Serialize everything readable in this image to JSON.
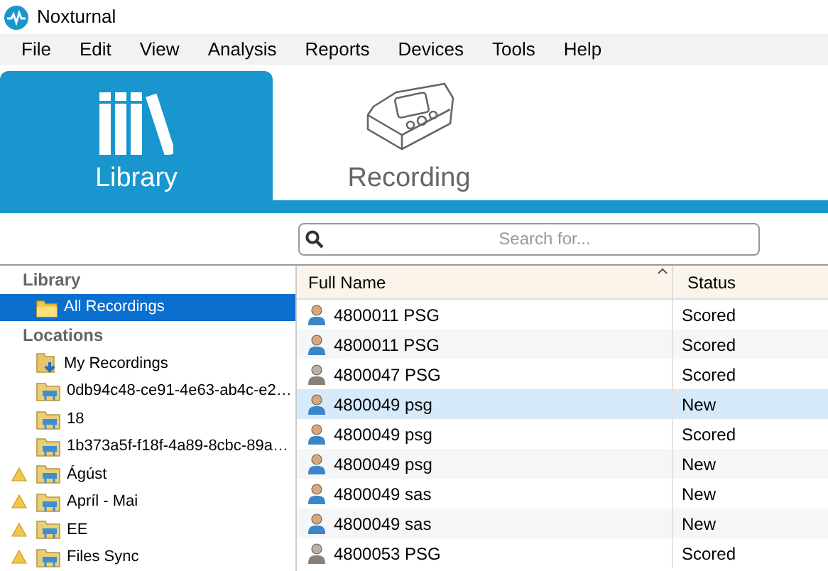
{
  "window": {
    "title": "Noxturnal"
  },
  "menu": [
    "File",
    "Edit",
    "View",
    "Analysis",
    "Reports",
    "Devices",
    "Tools",
    "Help"
  ],
  "tabs": [
    {
      "label": "Library",
      "kind": "library",
      "selected": true
    },
    {
      "label": "Recording",
      "kind": "device",
      "selected": false
    }
  ],
  "search": {
    "placeholder": "Search for..."
  },
  "sidebar": {
    "sections": [
      {
        "title": "Library",
        "items": [
          {
            "label": "All Recordings",
            "kind": "plain",
            "warning": false,
            "selected": true
          }
        ]
      },
      {
        "title": "Locations",
        "items": [
          {
            "label": "My Recordings",
            "kind": "download",
            "warning": false,
            "selected": false
          },
          {
            "label": "0db94c48-ce91-4e63-ab4c-e2…",
            "kind": "network",
            "warning": false,
            "selected": false
          },
          {
            "label": "18",
            "kind": "network",
            "warning": false,
            "selected": false
          },
          {
            "label": "1b373a5f-f18f-4a89-8cbc-89a…",
            "kind": "network",
            "warning": false,
            "selected": false
          },
          {
            "label": "Ágúst",
            "kind": "network",
            "warning": true,
            "selected": false
          },
          {
            "label": "Apríl - Mai",
            "kind": "network",
            "warning": true,
            "selected": false
          },
          {
            "label": "EE",
            "kind": "network",
            "warning": true,
            "selected": false
          },
          {
            "label": "Files Sync",
            "kind": "network",
            "warning": true,
            "selected": false
          }
        ]
      }
    ]
  },
  "table": {
    "columns": [
      "Full Name",
      "Status"
    ],
    "rows": [
      {
        "name": "4800011 PSG",
        "status": "Scored",
        "kind": "blue",
        "selected": false
      },
      {
        "name": "4800011 PSG",
        "status": "Scored",
        "kind": "blue",
        "selected": false
      },
      {
        "name": "4800047 PSG",
        "status": "Scored",
        "kind": "grey",
        "selected": false
      },
      {
        "name": "4800049 psg",
        "status": "New",
        "kind": "blue",
        "selected": true
      },
      {
        "name": "4800049 psg",
        "status": "Scored",
        "kind": "blue",
        "selected": false
      },
      {
        "name": "4800049 psg",
        "status": "New",
        "kind": "blue",
        "selected": false
      },
      {
        "name": "4800049 sas",
        "status": "New",
        "kind": "blue",
        "selected": false
      },
      {
        "name": "4800049 sas",
        "status": "New",
        "kind": "blue",
        "selected": false
      },
      {
        "name": "4800053 PSG",
        "status": "Scored",
        "kind": "grey",
        "selected": false
      }
    ]
  }
}
